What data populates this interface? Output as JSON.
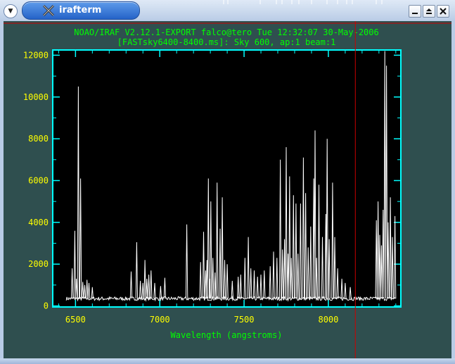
{
  "window": {
    "title": "irafterm",
    "menu_icon": "chevron-down-icon",
    "app_icon": "x-logo-icon",
    "buttons": [
      {
        "name": "minimize-button",
        "icon": "minimize-icon"
      },
      {
        "name": "maximize-button",
        "icon": "maximize-icon"
      },
      {
        "name": "close-button",
        "icon": "close-icon"
      }
    ]
  },
  "plot": {
    "header_line1": "NOAO/IRAF V2.12.1-EXPORT falco@tero Tue 12:32:07 30-May-2006",
    "header_line2": "[FASTsky6400-8400.ms]: Sky 600, ap:1 beam:1"
  },
  "colors": {
    "background": "#2f4f4f",
    "header_text": "#00ff00",
    "axis_frame": "#00ffff",
    "tick_labels": "#ffff00",
    "plot_area": "#000000",
    "spectrum": "#ffffff",
    "cursor": "#cc0000"
  },
  "chart_data": {
    "type": "line",
    "xlabel": "Wavelength (angstroms)",
    "ylabel": "",
    "xlim": [
      6365,
      8430
    ],
    "ylim": [
      -50,
      12250
    ],
    "x_ticks": [
      6500,
      7000,
      7500,
      8000
    ],
    "y_ticks": [
      0,
      2000,
      4000,
      6000,
      8000,
      10000,
      12000
    ],
    "cursor_x": 8160,
    "baseline": 350,
    "series": [
      {
        "emission_lines": [
          {
            "x": 6480,
            "y": 1800
          },
          {
            "x": 6496,
            "y": 3600
          },
          {
            "x": 6505,
            "y": 1300
          },
          {
            "x": 6517,
            "y": 10500
          },
          {
            "x": 6530,
            "y": 6100
          },
          {
            "x": 6543,
            "y": 1150
          },
          {
            "x": 6555,
            "y": 1000
          },
          {
            "x": 6568,
            "y": 1250
          },
          {
            "x": 6580,
            "y": 1100
          },
          {
            "x": 6600,
            "y": 900
          },
          {
            "x": 6830,
            "y": 1650
          },
          {
            "x": 6863,
            "y": 3050
          },
          {
            "x": 6885,
            "y": 1200
          },
          {
            "x": 6900,
            "y": 1100
          },
          {
            "x": 6912,
            "y": 2200
          },
          {
            "x": 6923,
            "y": 1300
          },
          {
            "x": 6935,
            "y": 1500
          },
          {
            "x": 6948,
            "y": 1700
          },
          {
            "x": 6970,
            "y": 1100
          },
          {
            "x": 7005,
            "y": 950
          },
          {
            "x": 7030,
            "y": 1350
          },
          {
            "x": 7160,
            "y": 3900
          },
          {
            "x": 7242,
            "y": 2100
          },
          {
            "x": 7260,
            "y": 3550
          },
          {
            "x": 7272,
            "y": 1700
          },
          {
            "x": 7280,
            "y": 2200
          },
          {
            "x": 7288,
            "y": 6100
          },
          {
            "x": 7297,
            "y": 1300
          },
          {
            "x": 7303,
            "y": 5000
          },
          {
            "x": 7315,
            "y": 2300
          },
          {
            "x": 7328,
            "y": 1600
          },
          {
            "x": 7340,
            "y": 5900
          },
          {
            "x": 7358,
            "y": 3700
          },
          {
            "x": 7371,
            "y": 5200
          },
          {
            "x": 7385,
            "y": 2200
          },
          {
            "x": 7400,
            "y": 2000
          },
          {
            "x": 7430,
            "y": 1200
          },
          {
            "x": 7465,
            "y": 1400
          },
          {
            "x": 7480,
            "y": 1500
          },
          {
            "x": 7505,
            "y": 2300
          },
          {
            "x": 7525,
            "y": 3300
          },
          {
            "x": 7540,
            "y": 1800
          },
          {
            "x": 7560,
            "y": 1700
          },
          {
            "x": 7580,
            "y": 1400
          },
          {
            "x": 7600,
            "y": 1500
          },
          {
            "x": 7620,
            "y": 1700
          },
          {
            "x": 7655,
            "y": 1900
          },
          {
            "x": 7675,
            "y": 2600
          },
          {
            "x": 7695,
            "y": 2300
          },
          {
            "x": 7715,
            "y": 7000
          },
          {
            "x": 7728,
            "y": 2700
          },
          {
            "x": 7740,
            "y": 3200
          },
          {
            "x": 7750,
            "y": 7600
          },
          {
            "x": 7761,
            "y": 2500
          },
          {
            "x": 7770,
            "y": 6200
          },
          {
            "x": 7780,
            "y": 2300
          },
          {
            "x": 7793,
            "y": 5300
          },
          {
            "x": 7808,
            "y": 4900
          },
          {
            "x": 7820,
            "y": 2500
          },
          {
            "x": 7835,
            "y": 4900
          },
          {
            "x": 7852,
            "y": 7100
          },
          {
            "x": 7865,
            "y": 5400
          },
          {
            "x": 7880,
            "y": 2800
          },
          {
            "x": 7895,
            "y": 3800
          },
          {
            "x": 7913,
            "y": 6100
          },
          {
            "x": 7921,
            "y": 8400
          },
          {
            "x": 7930,
            "y": 2300
          },
          {
            "x": 7944,
            "y": 5800
          },
          {
            "x": 7965,
            "y": 3300
          },
          {
            "x": 7985,
            "y": 4400
          },
          {
            "x": 7993,
            "y": 8000
          },
          {
            "x": 8005,
            "y": 3200
          },
          {
            "x": 8025,
            "y": 5900
          },
          {
            "x": 8038,
            "y": 3300
          },
          {
            "x": 8055,
            "y": 1800
          },
          {
            "x": 8080,
            "y": 1300
          },
          {
            "x": 8100,
            "y": 1100
          },
          {
            "x": 8130,
            "y": 900
          },
          {
            "x": 8285,
            "y": 4100
          },
          {
            "x": 8295,
            "y": 5000
          },
          {
            "x": 8305,
            "y": 3400
          },
          {
            "x": 8315,
            "y": 2900
          },
          {
            "x": 8325,
            "y": 4600
          },
          {
            "x": 8335,
            "y": 12200
          },
          {
            "x": 8345,
            "y": 11500
          },
          {
            "x": 8355,
            "y": 4000
          },
          {
            "x": 8368,
            "y": 5200
          },
          {
            "x": 8380,
            "y": 3300
          },
          {
            "x": 8395,
            "y": 4300
          }
        ]
      }
    ]
  }
}
